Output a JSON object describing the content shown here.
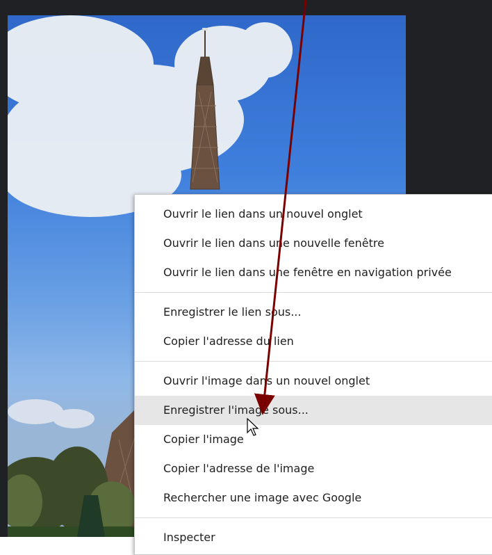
{
  "context_menu": {
    "groups": [
      {
        "items": [
          {
            "label": "Ouvrir le lien dans un nouvel onglet"
          },
          {
            "label": "Ouvrir le lien dans une nouvelle fenêtre"
          },
          {
            "label": "Ouvrir le lien dans une fenêtre en navigation privée"
          }
        ]
      },
      {
        "items": [
          {
            "label": "Enregistrer le lien sous..."
          },
          {
            "label": "Copier l'adresse du lien"
          }
        ]
      },
      {
        "items": [
          {
            "label": "Ouvrir l'image dans un nouvel onglet"
          },
          {
            "label": "Enregistrer l'image sous...",
            "highlighted": true
          },
          {
            "label": "Copier l'image"
          },
          {
            "label": "Copier l'adresse de l'image"
          },
          {
            "label": "Rechercher une image avec Google"
          }
        ]
      },
      {
        "items": [
          {
            "label": "Inspecter"
          }
        ]
      }
    ]
  },
  "annotation": {
    "arrow_color": "#7a0000"
  },
  "colors": {
    "backdrop": "#202124",
    "menu_highlight": "#e6e6e6"
  }
}
